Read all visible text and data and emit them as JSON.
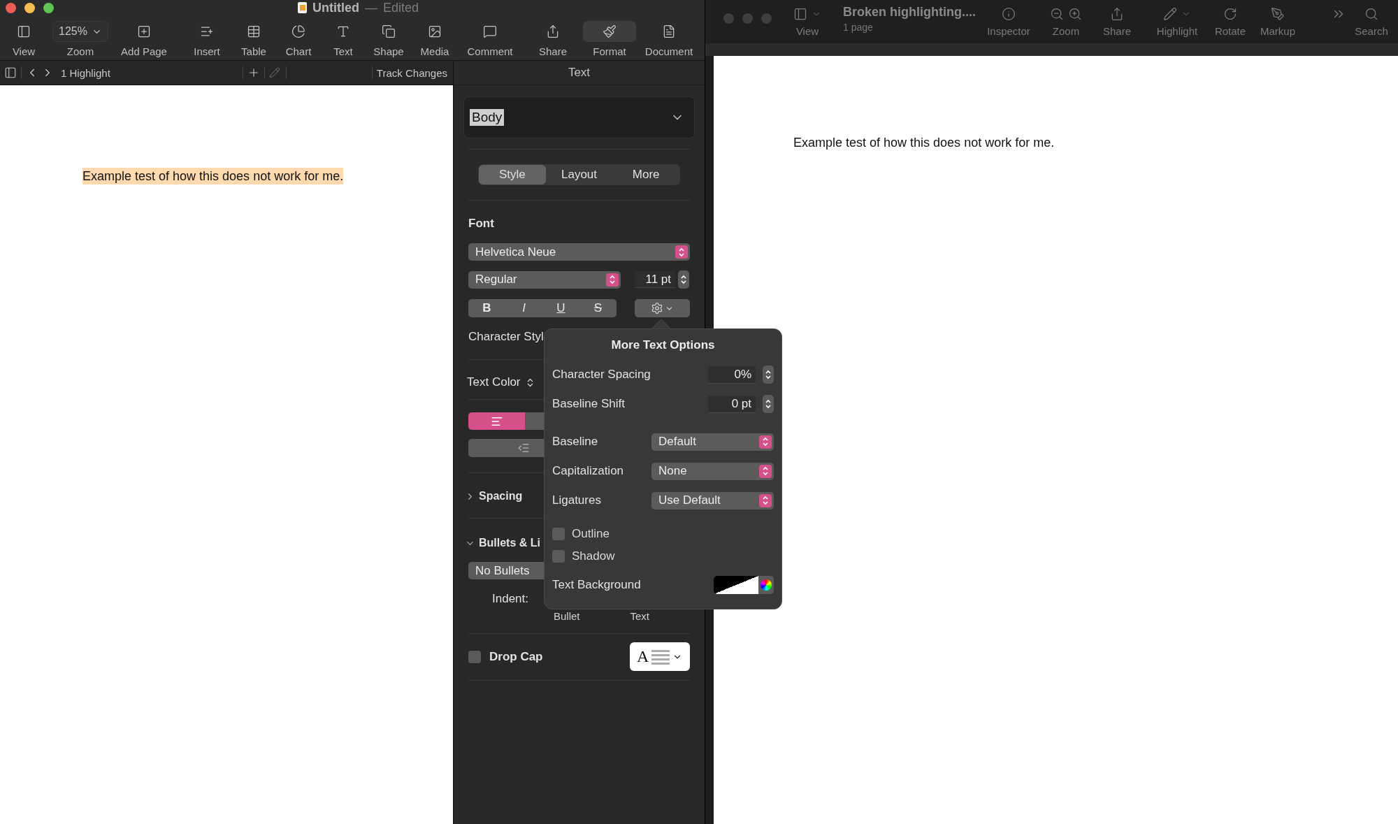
{
  "pages_window": {
    "title": "Untitled",
    "title_separator": "—",
    "title_status": "Edited",
    "toolbar": [
      {
        "kind": "button",
        "label": "View",
        "selected": false
      },
      {
        "kind": "dropdown",
        "label": "Zoom",
        "value": "125%",
        "selected": false
      },
      {
        "kind": "button",
        "label": "Add Page",
        "selected": false
      },
      {
        "kind": "button",
        "label": "Insert",
        "selected": false
      },
      {
        "kind": "button",
        "label": "Table",
        "selected": false
      },
      {
        "kind": "button",
        "label": "Chart",
        "selected": false
      },
      {
        "kind": "button",
        "label": "Text",
        "selected": false
      },
      {
        "kind": "button",
        "label": "Shape",
        "selected": false
      },
      {
        "kind": "button",
        "label": "Media",
        "selected": false
      },
      {
        "kind": "button",
        "label": "Comment",
        "selected": false
      },
      {
        "kind": "button",
        "label": "Share",
        "selected": false
      },
      {
        "kind": "button",
        "label": "Format",
        "selected": true
      },
      {
        "kind": "button",
        "label": "Document",
        "selected": false
      }
    ],
    "secondary_bar": {
      "count_label": "1 Highlight",
      "track_changes": "Track Changes"
    },
    "document": {
      "text": "Example test of how this does not work for me.",
      "highlighted": true
    },
    "inspector": {
      "header": "Text",
      "paragraph_style": "Body",
      "tabs": [
        {
          "label": "Style",
          "selected": true
        },
        {
          "label": "Layout",
          "selected": false
        },
        {
          "label": "More",
          "selected": false
        }
      ],
      "font_label": "Font",
      "font_family": "Helvetica Neue",
      "font_typeface": "Regular",
      "font_size": "11 pt",
      "format_buttons": [
        {
          "kind": "bold",
          "label": "B"
        },
        {
          "kind": "italic",
          "label": "I"
        },
        {
          "kind": "underline",
          "label": "U"
        },
        {
          "kind": "strike",
          "label": "S"
        }
      ],
      "character_styles_label": "Character Styl",
      "text_color_label": "Text Color",
      "alignment": [
        {
          "selected": true
        },
        {
          "selected": false
        }
      ],
      "spacing": {
        "label": "Spacing",
        "expanded": false
      },
      "bullets": {
        "label": "Bullets & Li",
        "expanded": true,
        "value": "No Bullets",
        "indent_label": "Indent:",
        "captions": [
          "Bullet",
          "Text"
        ]
      },
      "drop_cap": {
        "label": "Drop Cap",
        "checked": false,
        "preview_letter": "A"
      }
    },
    "popover": {
      "title": "More Text Options",
      "rows": [
        {
          "kind": "stepper",
          "label": "Character Spacing",
          "value": "0%"
        },
        {
          "kind": "stepper",
          "label": "Baseline Shift",
          "value": "0 pt"
        },
        {
          "kind": "select",
          "label": "Baseline",
          "value": "Default"
        },
        {
          "kind": "select",
          "label": "Capitalization",
          "value": "None"
        },
        {
          "kind": "select",
          "label": "Ligatures",
          "value": "Use Default"
        },
        {
          "kind": "checkbox",
          "label": "Outline",
          "checked": false
        },
        {
          "kind": "checkbox",
          "label": "Shadow",
          "checked": false
        },
        {
          "kind": "color",
          "label": "Text Background"
        }
      ]
    }
  },
  "preview_window": {
    "title": "Broken highlighting....",
    "subtitle": "1 page",
    "toolbar": [
      {
        "label": "View"
      },
      {
        "label": "Inspector"
      },
      {
        "label": "Zoom"
      },
      {
        "label": "Share"
      },
      {
        "label": "Highlight"
      },
      {
        "label": "Rotate"
      },
      {
        "label": "Markup"
      },
      {
        "label": "Search"
      }
    ],
    "document_text": "Example test of how this does not work for me."
  }
}
